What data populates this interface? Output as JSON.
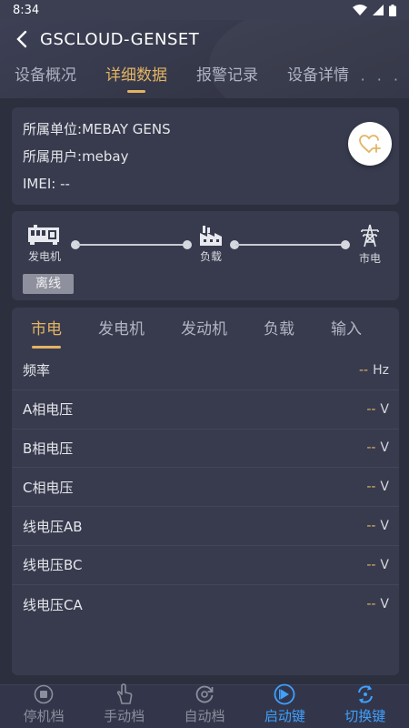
{
  "status": {
    "time": "8:34"
  },
  "header": {
    "title": "GSCLOUD-GENSET",
    "more": "· · ·"
  },
  "top_tabs": [
    {
      "label": "设备概况"
    },
    {
      "label": "详细数据"
    },
    {
      "label": "报警记录"
    },
    {
      "label": "设备详情"
    }
  ],
  "info": {
    "unit_label": "所属单位:",
    "unit_value": "MEBAY GENS",
    "user_label": "所属用户:",
    "user_value": "mebay",
    "imei_label": "IMEI:",
    "imei_value": "--"
  },
  "flow": {
    "generator": "发电机",
    "load": "负载",
    "mains": "市电",
    "status": "离线"
  },
  "sub_tabs": [
    {
      "label": "市电"
    },
    {
      "label": "发电机"
    },
    {
      "label": "发动机"
    },
    {
      "label": "负载"
    },
    {
      "label": "输入"
    }
  ],
  "rows": [
    {
      "label": "频率",
      "value": "--",
      "unit": "Hz"
    },
    {
      "label": "A相电压",
      "value": "--",
      "unit": "V"
    },
    {
      "label": "B相电压",
      "value": "--",
      "unit": "V"
    },
    {
      "label": "C相电压",
      "value": "--",
      "unit": "V"
    },
    {
      "label": "线电压AB",
      "value": "--",
      "unit": "V"
    },
    {
      "label": "线电压BC",
      "value": "--",
      "unit": "V"
    },
    {
      "label": "线电压CA",
      "value": "--",
      "unit": "V"
    }
  ],
  "bottom": [
    {
      "label": "停机档",
      "icon": "stop-icon"
    },
    {
      "label": "手动档",
      "icon": "hand-icon"
    },
    {
      "label": "自动档",
      "icon": "auto-icon"
    },
    {
      "label": "启动键",
      "icon": "play-icon"
    },
    {
      "label": "切换键",
      "icon": "switch-icon"
    }
  ],
  "colors": {
    "accent": "#e3b463",
    "blue": "#3ea0ff",
    "background": "#2c2f3e",
    "card": "#383b4e"
  }
}
